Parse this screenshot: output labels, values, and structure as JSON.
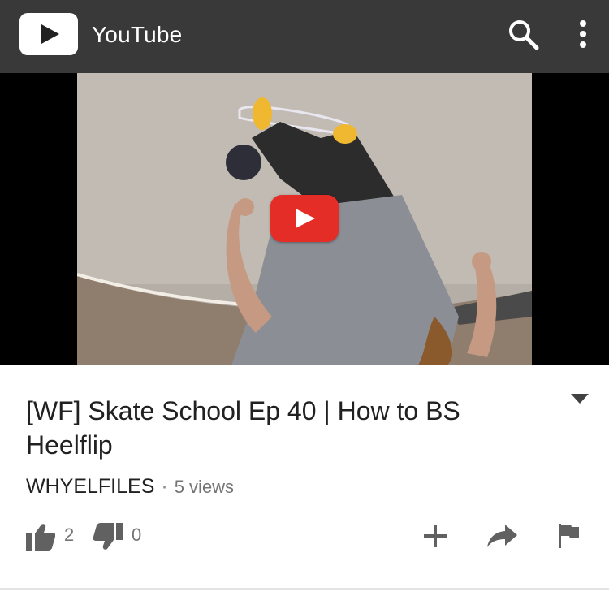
{
  "app_bar": {
    "title": "YouTube",
    "logo_icon": "youtube-play-icon",
    "search_icon": "search-icon",
    "menu_icon": "more-vert-icon",
    "background": "#3a3939"
  },
  "player": {
    "play_icon": "play-icon",
    "play_button_color": "#e52d27"
  },
  "video": {
    "title": "[WF] Skate School Ep 40 | How to BS Heelflip",
    "channel": "WHYELFILES",
    "separator": "·",
    "views": "5 views"
  },
  "actions": {
    "likes": "2",
    "dislikes": "0",
    "icons": [
      "thumb-up-icon",
      "thumb-down-icon",
      "add-icon",
      "share-icon",
      "flag-icon"
    ]
  }
}
